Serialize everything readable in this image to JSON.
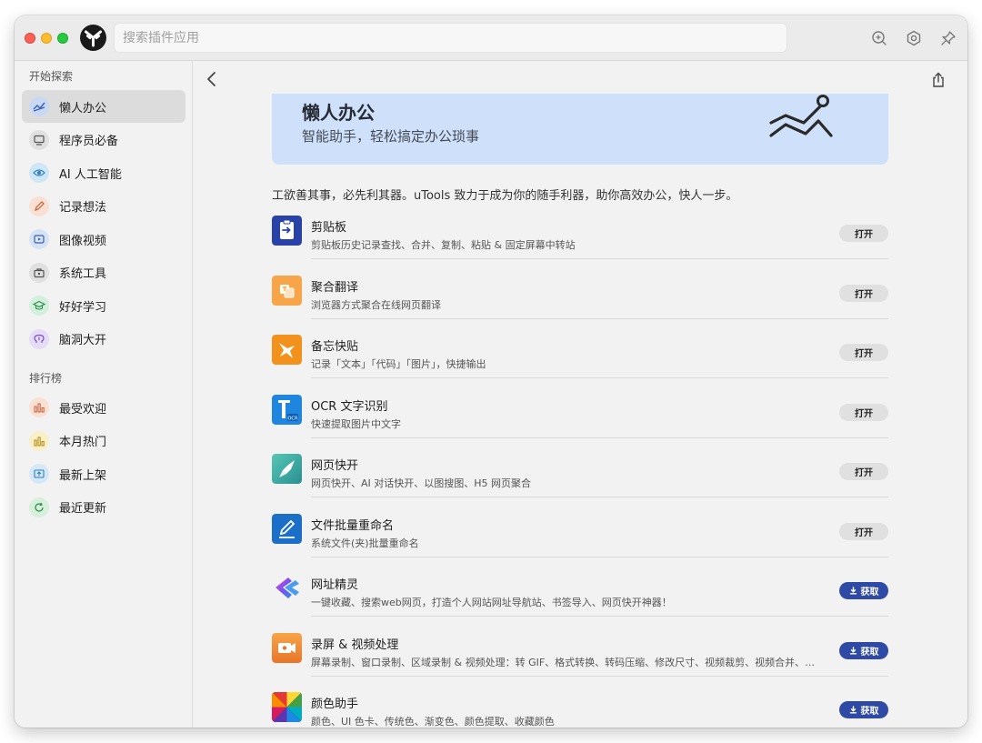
{
  "titlebar": {
    "search_placeholder": "搜索插件应用"
  },
  "sidebar": {
    "section_explore": "开始探索",
    "explore_items": [
      {
        "label": "懒人办公",
        "icon": "chart-wave-icon",
        "color": "#c9d8f5",
        "active": true
      },
      {
        "label": "程序员必备",
        "icon": "monitor-icon",
        "color": "#e0e0e0"
      },
      {
        "label": "AI 人工智能",
        "icon": "eye-icon",
        "color": "#cfe6f7"
      },
      {
        "label": "记录想法",
        "icon": "pencil-icon",
        "color": "#f9e0d3"
      },
      {
        "label": "图像视频",
        "icon": "video-icon",
        "color": "#d6e3f7"
      },
      {
        "label": "系统工具",
        "icon": "toolbox-icon",
        "color": "#e0e0e0"
      },
      {
        "label": "好好学习",
        "icon": "graduation-cap-icon",
        "color": "#d2f0dc"
      },
      {
        "label": "脑洞大开",
        "icon": "brain-icon",
        "color": "#e6dcf7"
      }
    ],
    "section_ranking": "排行榜",
    "ranking_items": [
      {
        "label": "最受欢迎",
        "icon": "bar-chart-icon",
        "color": "#f9e0d3"
      },
      {
        "label": "本月热门",
        "icon": "bar-chart-icon",
        "color": "#f9efc8"
      },
      {
        "label": "最新上架",
        "icon": "upload-icon",
        "color": "#d6e8f7"
      },
      {
        "label": "最近更新",
        "icon": "refresh-icon",
        "color": "#d6f0dc"
      }
    ]
  },
  "main": {
    "banner": {
      "title": "懒人办公",
      "subtitle": "智能助手，轻松搞定办公琐事"
    },
    "intro": "工欲善其事，必先利其器。uTools 致力于成为你的随手利器，助你高效办公，快人一步。",
    "open_label": "打开",
    "get_label": "获取",
    "plugins": [
      {
        "name": "剪贴板",
        "desc": "剪贴板历史记录查找、合并、复制、粘贴 & 固定屏幕中转站",
        "action": "open",
        "icon": "clipboard-icon"
      },
      {
        "name": "聚合翻译",
        "desc": "浏览器方式聚合在线网页翻译",
        "action": "open",
        "icon": "translate-icon"
      },
      {
        "name": "备忘快贴",
        "desc": "记录「文本」「代码」「图片」，快捷输出",
        "action": "open",
        "icon": "sticky-star-icon"
      },
      {
        "name": "OCR 文字识别",
        "desc": "快速提取图片中文字",
        "action": "open",
        "icon": "ocr-icon"
      },
      {
        "name": "网页快开",
        "desc": "网页快开、AI 对话快开、以图搜图、H5 网页聚合",
        "action": "open",
        "icon": "rocket-icon"
      },
      {
        "name": "文件批量重命名",
        "desc": "系统文件(夹)批量重命名",
        "action": "open",
        "icon": "rename-pen-icon"
      },
      {
        "name": "网址精灵",
        "desc": "一键收藏、搜索web网页，打造个人网站网址导航站、书签导入、网页快开神器！",
        "action": "get",
        "icon": "url-sprite-icon"
      },
      {
        "name": "录屏 & 视频处理",
        "desc": "屏幕录制、窗口录制、区域录制 & 视频处理：转 GIF、格式转换、转码压缩、修改尺寸、视频裁剪、视频合并、视频...",
        "action": "get",
        "icon": "screen-record-icon"
      },
      {
        "name": "颜色助手",
        "desc": "颜色、UI 色卡、传统色、渐变色、颜色提取、收藏颜色",
        "action": "get",
        "icon": "color-palette-icon"
      }
    ]
  }
}
